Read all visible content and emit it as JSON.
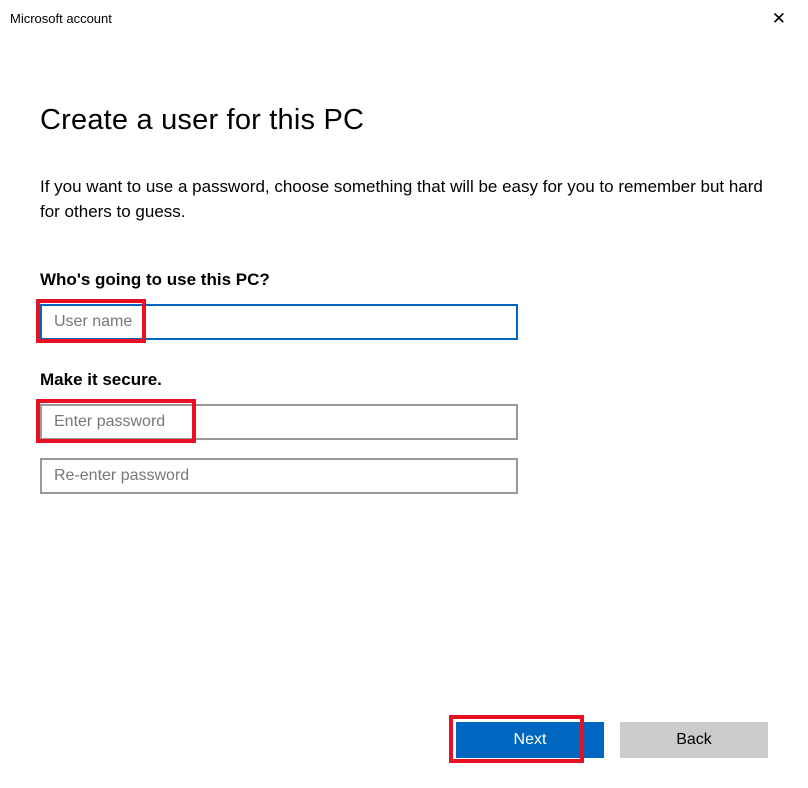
{
  "window": {
    "title": "Microsoft account"
  },
  "main": {
    "heading": "Create a user for this PC",
    "description": "If you want to use a password, choose something that will be easy for you to remember but hard for others to guess.",
    "section1_label": "Who's going to use this PC?",
    "username_placeholder": "User name",
    "section2_label": "Make it secure.",
    "password_placeholder": "Enter password",
    "reenter_placeholder": "Re-enter password"
  },
  "footer": {
    "next_label": "Next",
    "back_label": "Back"
  }
}
